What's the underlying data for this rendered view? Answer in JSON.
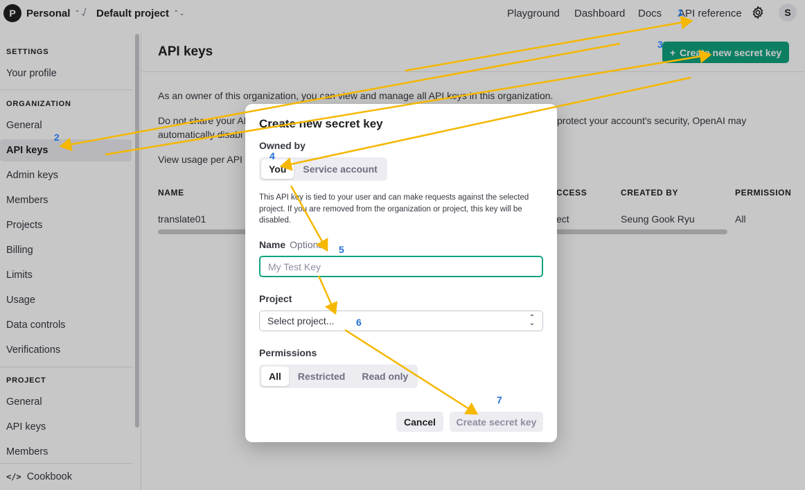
{
  "topbar": {
    "org_initial": "P",
    "org_name": "Personal",
    "project_name": "Default project",
    "nav": [
      "Playground",
      "Dashboard",
      "Docs",
      "API reference"
    ],
    "user_initial": "S"
  },
  "sidebar": {
    "settings_heading": "SETTINGS",
    "settings_items": [
      "Your profile"
    ],
    "organization_heading": "ORGANIZATION",
    "organization_items": [
      "General",
      "API keys",
      "Admin keys",
      "Members",
      "Projects",
      "Billing",
      "Limits",
      "Usage",
      "Data controls",
      "Verifications"
    ],
    "project_heading": "PROJECT",
    "project_items": [
      "General",
      "API keys",
      "Members"
    ],
    "cookbook_label": "Cookbook"
  },
  "main": {
    "title": "API keys",
    "create_button": "Create new secret key",
    "para1": "As an owner of this organization, you can view and manage all API keys in this organization.",
    "para2_left": "Do not share your AP",
    "para2_left_line2": "automatically disabl",
    "para2_right": "protect your account's security, OpenAI may",
    "para3": "View usage per API k",
    "table": {
      "headers": [
        "NAME",
        "CCESS",
        "CREATED BY",
        "PERMISSION"
      ],
      "row": [
        "translate01",
        "ect",
        "Seung Gook Ryu",
        "All"
      ]
    }
  },
  "modal": {
    "title": "Create new secret key",
    "owned_by_label": "Owned by",
    "owned_by_options": [
      "You",
      "Service account"
    ],
    "owned_by_selected": "You",
    "help_text": "This API key is tied to your user and can make requests against the selected project. If you are removed from the organization or project, this key will be disabled.",
    "name_label": "Name",
    "name_optional": "Optional",
    "name_placeholder": "My Test Key",
    "project_label": "Project",
    "project_placeholder": "Select project...",
    "permissions_label": "Permissions",
    "permission_options": [
      "All",
      "Restricted",
      "Read only"
    ],
    "permission_selected": "All",
    "cancel_label": "Cancel",
    "submit_label": "Create secret key"
  },
  "annotations": {
    "color": "#f5b700",
    "number_color": "#1f6fd6",
    "steps": [
      "1",
      "2",
      "3",
      "4",
      "5",
      "6",
      "7"
    ]
  },
  "colors": {
    "accent": "#10a37f"
  }
}
